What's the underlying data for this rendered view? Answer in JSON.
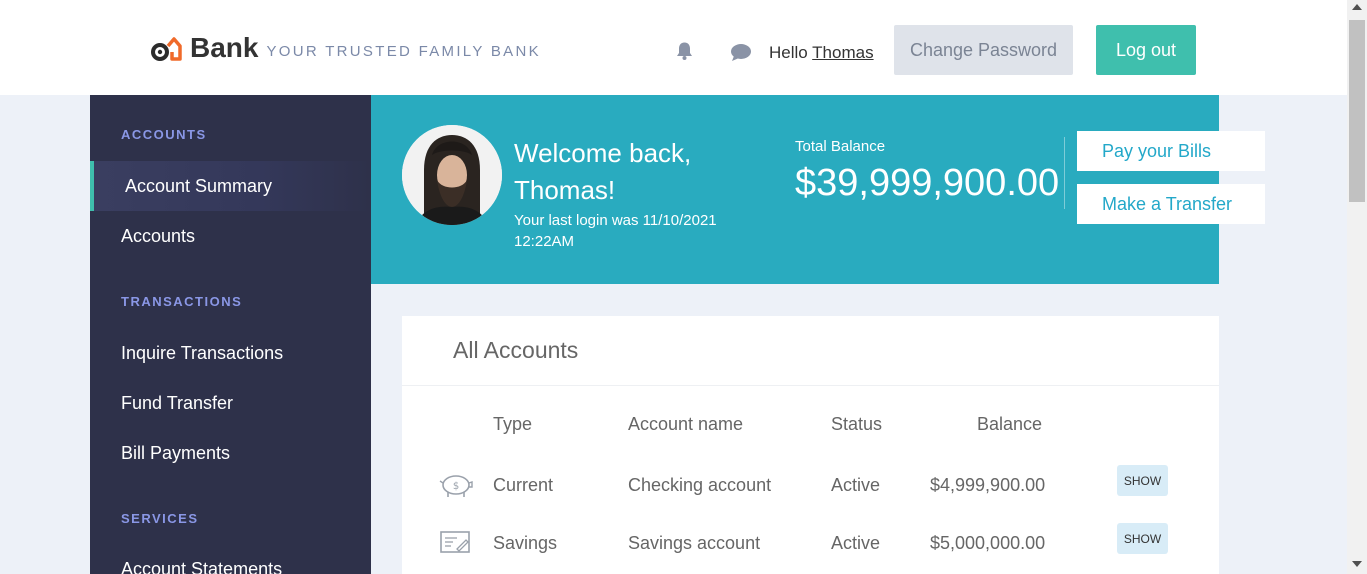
{
  "header": {
    "brand": "Bank",
    "tagline": "YOUR TRUSTED FAMILY BANK",
    "greeting": "Hello",
    "user": "Thomas",
    "change_password": "Change Password",
    "logout": "Log out"
  },
  "sidebar": {
    "sections": [
      {
        "heading": "ACCOUNTS",
        "items": [
          "Account Summary",
          "Accounts"
        ]
      },
      {
        "heading": "TRANSACTIONS",
        "items": [
          "Inquire Transactions",
          "Fund Transfer",
          "Bill Payments"
        ]
      },
      {
        "heading": "SERVICES",
        "items": [
          "Account Statements"
        ]
      }
    ]
  },
  "banner": {
    "welcome": "Welcome back, Thomas!",
    "last_login": "Your last login was 11/10/2021 12:22AM",
    "total_label": "Total Balance",
    "total_value": "$39,999,900.00",
    "pay_bills": "Pay your Bills",
    "transfer": "Make a Transfer"
  },
  "accounts": {
    "title": "All Accounts",
    "columns": [
      "Type",
      "Account name",
      "Status",
      "Balance"
    ],
    "rows": [
      {
        "icon": "piggy-bank-icon",
        "type": "Current",
        "name": "Checking account",
        "status": "Active",
        "balance": "$4,999,900.00",
        "action": "SHOW"
      },
      {
        "icon": "check-icon",
        "type": "Savings",
        "name": "Savings account",
        "status": "Active",
        "balance": "$5,000,000.00",
        "action": "SHOW"
      }
    ]
  },
  "colors": {
    "accent": "#3fbfad",
    "banner": "#29abbf",
    "sidebar": "#2e314a",
    "link_blue": "#23a8c9"
  }
}
